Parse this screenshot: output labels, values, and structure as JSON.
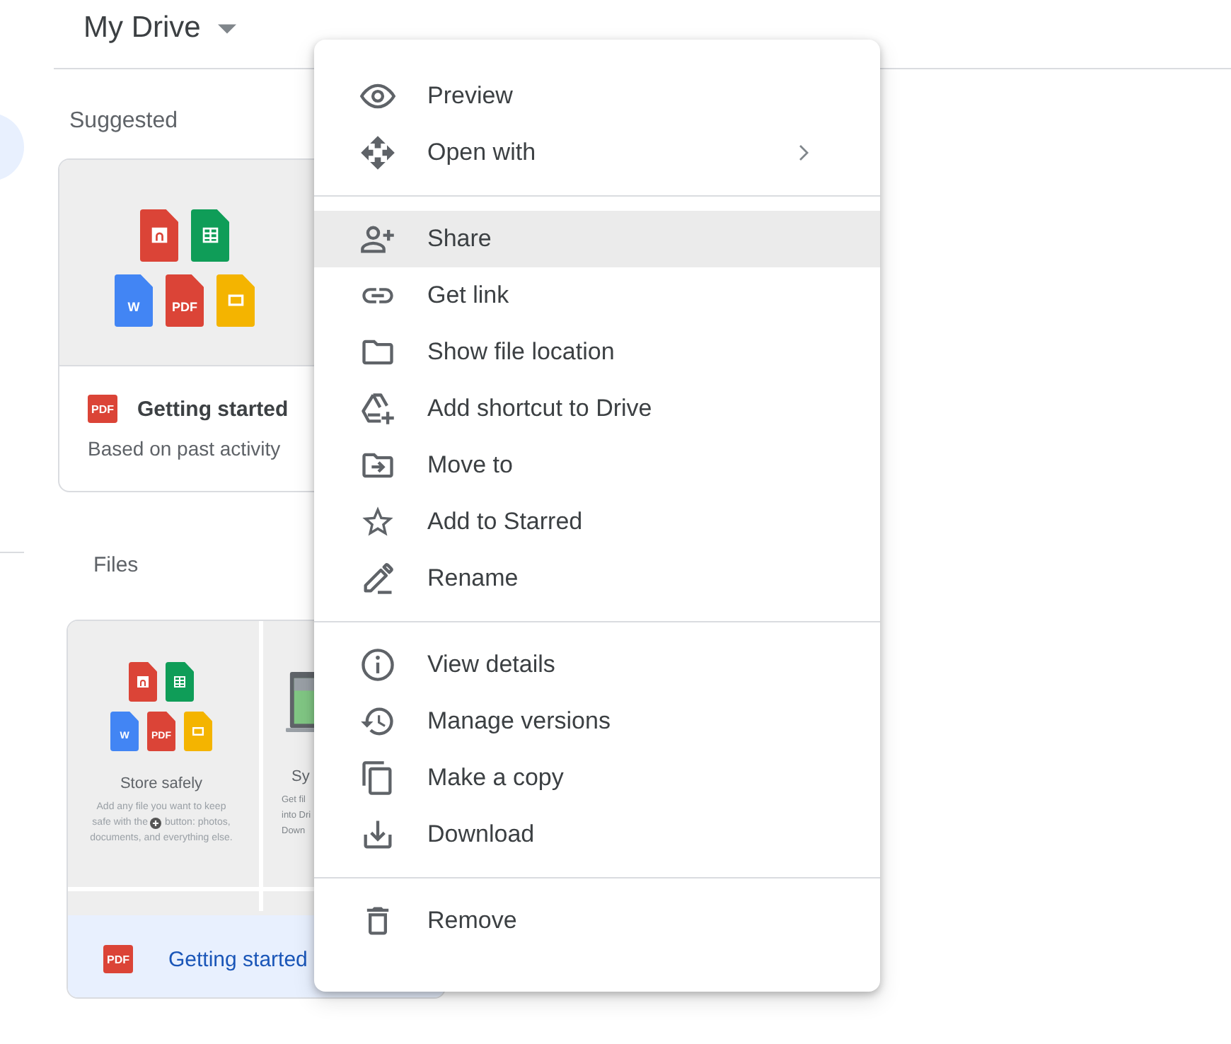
{
  "header": {
    "title": "My Drive"
  },
  "suggested": {
    "heading": "Suggested",
    "card": {
      "tiles": [
        {
          "kind": "audio",
          "color": "#db4437"
        },
        {
          "kind": "sheet",
          "color": "#0f9d58"
        },
        {
          "kind": "doc",
          "color": "#4285f4",
          "label": "W"
        },
        {
          "kind": "pdf",
          "color": "#db4437",
          "label": "PDF"
        },
        {
          "kind": "slides",
          "color": "#f4b400"
        }
      ],
      "file_badge": "PDF",
      "title": "Getting started",
      "subtitle": "Based on past activity"
    }
  },
  "files": {
    "heading": "Files",
    "card": {
      "selected": true,
      "preview": {
        "tiles": [
          {
            "kind": "audio",
            "color": "#db4437"
          },
          {
            "kind": "sheet",
            "color": "#0f9d58"
          },
          {
            "kind": "doc",
            "color": "#4285f4",
            "label": "W"
          },
          {
            "kind": "pdf",
            "color": "#db4437",
            "label": "PDF"
          },
          {
            "kind": "slides",
            "color": "#f4b400"
          }
        ],
        "title": "Store safely",
        "lines": [
          [
            "Add any file you want to keep"
          ],
          [
            "safe with the",
            "button: photos,"
          ],
          [
            "documents, and everything else."
          ]
        ],
        "second_title": "Sy",
        "second_lines": [
          "Get fil",
          "into Dri",
          "Down"
        ]
      },
      "file_badge": "PDF",
      "title": "Getting started"
    }
  },
  "context_menu": {
    "groups": [
      [
        {
          "kind": "eye",
          "label": "Preview",
          "selected": false
        },
        {
          "kind": "move",
          "label": "Open with",
          "selected": false,
          "submenu": true
        }
      ],
      [
        {
          "kind": "person-add",
          "label": "Share",
          "selected": true
        },
        {
          "kind": "link",
          "label": "Get link",
          "selected": false
        },
        {
          "kind": "folder",
          "label": "Show file location",
          "selected": false
        },
        {
          "kind": "drive-add",
          "label": "Add shortcut to Drive",
          "selected": false
        },
        {
          "kind": "folder-move",
          "label": "Move to",
          "selected": false
        },
        {
          "kind": "star",
          "label": "Add to Starred",
          "selected": false
        },
        {
          "kind": "pencil",
          "label": "Rename",
          "selected": false
        }
      ],
      [
        {
          "kind": "info",
          "label": "View details",
          "selected": false
        },
        {
          "kind": "history",
          "label": "Manage versions",
          "selected": false
        },
        {
          "kind": "copy",
          "label": "Make a copy",
          "selected": false
        },
        {
          "kind": "download",
          "label": "Download",
          "selected": false
        }
      ],
      [
        {
          "kind": "trash",
          "label": "Remove",
          "selected": false
        }
      ]
    ]
  }
}
